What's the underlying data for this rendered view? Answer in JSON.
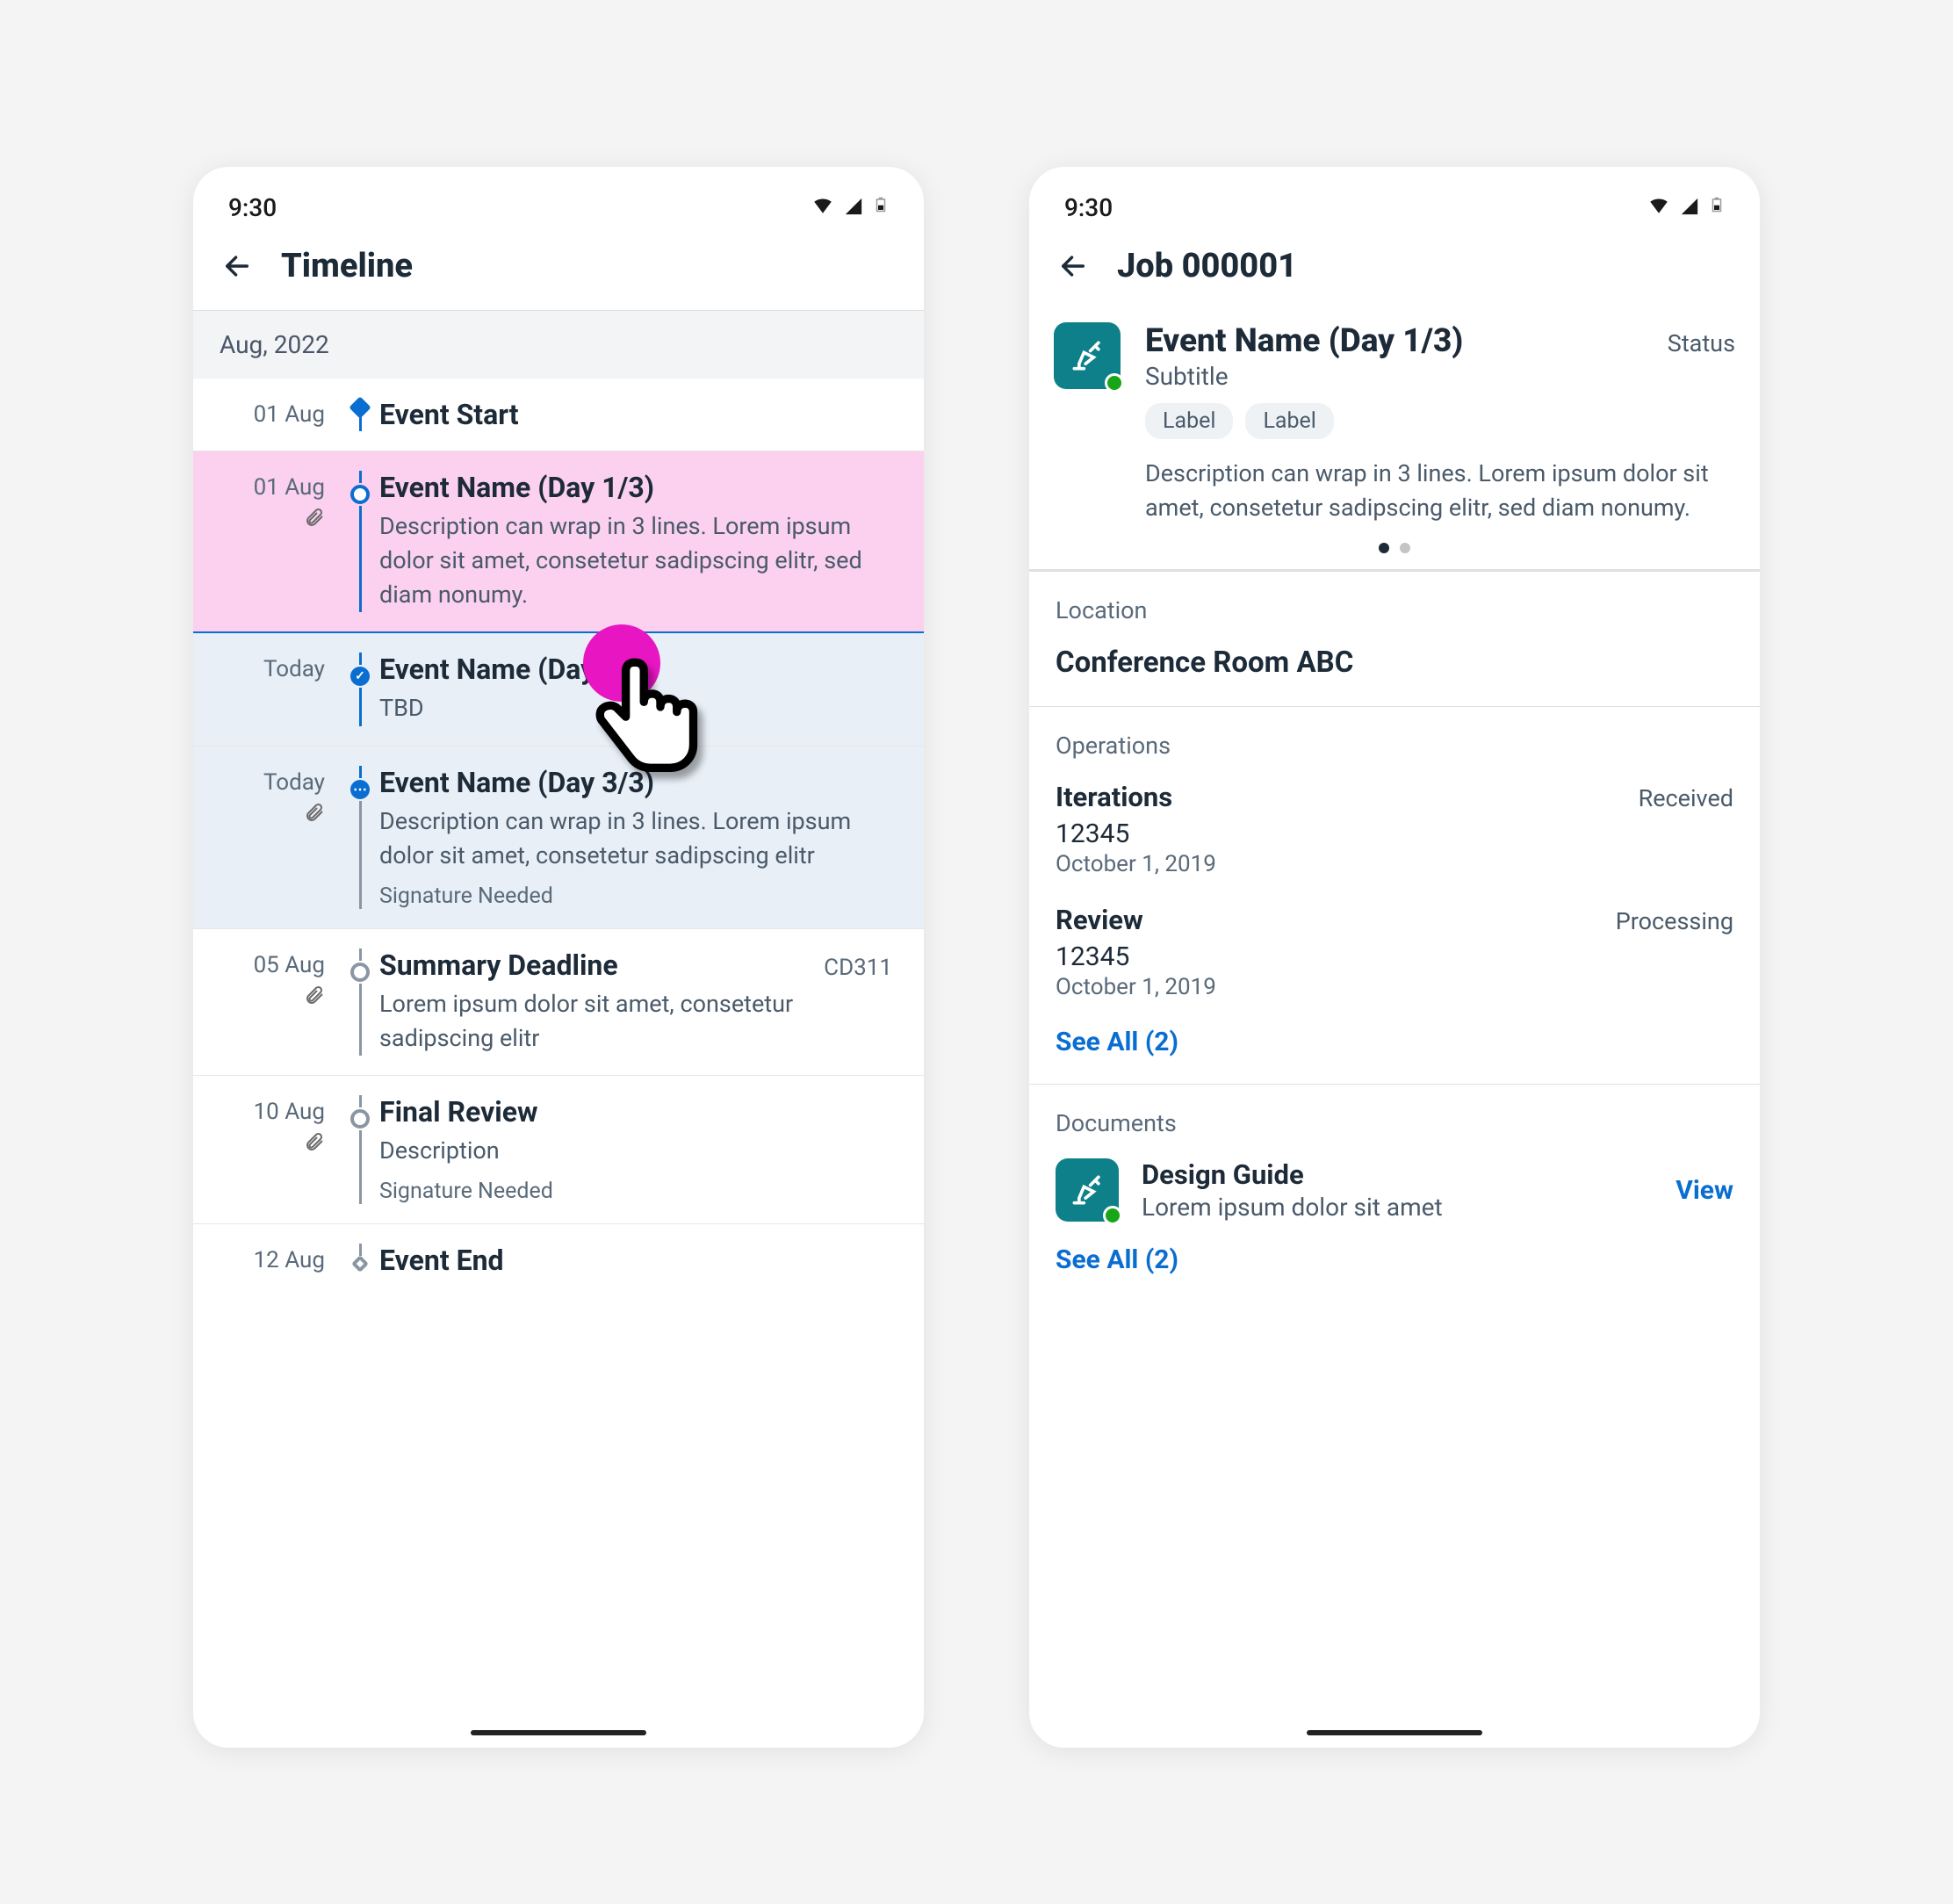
{
  "status_time": "9:30",
  "left": {
    "title": "Timeline",
    "month": "Aug, 2022",
    "items": [
      {
        "date": "01 Aug",
        "title": "Event Start"
      },
      {
        "date": "01 Aug",
        "title": "Event Name (Day 1/3)",
        "desc": "Description can wrap in 3 lines. Lorem ipsum dolor sit amet, consetetur sadipscing elitr, sed diam nonumy."
      },
      {
        "date": "Today",
        "title": "Event Name (Day 2/3)",
        "desc": "TBD"
      },
      {
        "date": "Today",
        "title": "Event Name (Day 3/3)",
        "desc": "Description can wrap in 3 lines. Lorem ipsum dolor sit amet, consetetur sadipscing elitr",
        "sub": "Signature Needed"
      },
      {
        "date": "05 Aug",
        "title": "Summary Deadline",
        "code": "CD311",
        "desc": "Lorem ipsum dolor sit amet, consetetur sadipscing elitr"
      },
      {
        "date": "10 Aug",
        "title": "Final Review",
        "desc": "Description",
        "sub": "Signature Needed"
      },
      {
        "date": "12 Aug",
        "title": "Event End"
      }
    ]
  },
  "right": {
    "title": "Job 000001",
    "event": {
      "title": "Event Name (Day 1/3)",
      "status": "Status",
      "subtitle": "Subtitle",
      "labels": [
        "Label",
        "Label"
      ],
      "desc": "Description can wrap in 3 lines. Lorem ipsum dolor sit amet, consetetur sadipscing elitr, sed diam nonumy."
    },
    "location": {
      "label": "Location",
      "value": "Conference Room ABC"
    },
    "operations": {
      "label": "Operations",
      "items": [
        {
          "title": "Iterations",
          "status": "Received",
          "number": "12345",
          "date": "October 1, 2019"
        },
        {
          "title": "Review",
          "status": "Processing",
          "number": "12345",
          "date": "October 1, 2019"
        }
      ],
      "see_all": "See All (2)"
    },
    "documents": {
      "label": "Documents",
      "item": {
        "title": "Design Guide",
        "desc": "Lorem ipsum dolor sit amet",
        "action": "View"
      },
      "see_all": "See All (2)"
    }
  }
}
